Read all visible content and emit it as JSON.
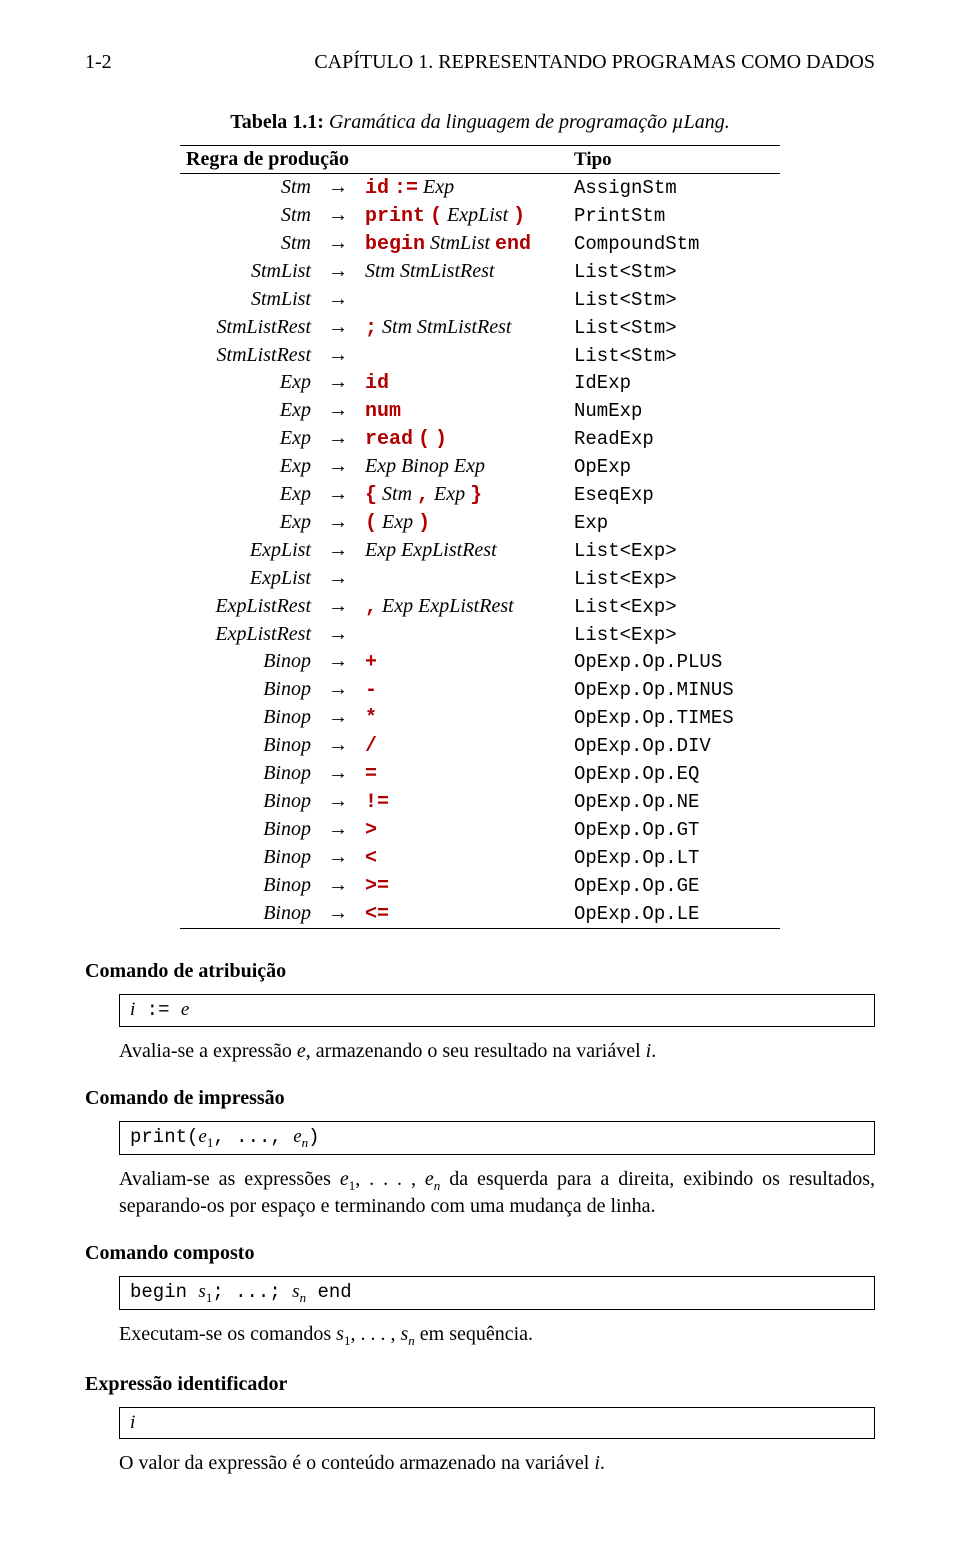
{
  "header": {
    "page_num": "1-2",
    "running": "CAPÍTULO 1.  REPRESENTANDO PROGRAMAS COMO DADOS"
  },
  "table": {
    "caption_label": "Tabela 1.1:",
    "caption_text": "Gramática da linguagem de programação µLang.",
    "head_lhs": "Regra de produção",
    "head_type": "Tipo"
  },
  "grammar": [
    {
      "lhs": "Stm",
      "rhs": "<span class='kw'>id</span> <span class='kw'>:=</span> <span class='it'>Exp</span>",
      "type": "AssignStm"
    },
    {
      "lhs": "Stm",
      "rhs": "<span class='kw'>print</span> <span class='kw'>(</span> <span class='it'>ExpList</span> <span class='kw'>)</span>",
      "type": "PrintStm"
    },
    {
      "lhs": "Stm",
      "rhs": "<span class='kw'>begin</span> <span class='it'>StmList</span> <span class='kw'>end</span>",
      "type": "CompoundStm"
    },
    {
      "lhs": "StmList",
      "rhs": "<span class='it'>Stm StmListRest</span>",
      "type": "List&lt;Stm&gt;"
    },
    {
      "lhs": "StmList",
      "rhs": "",
      "type": "List&lt;Stm&gt;"
    },
    {
      "lhs": "StmListRest",
      "rhs": "<span class='kw'>;</span> <span class='it'>Stm StmListRest</span>",
      "type": "List&lt;Stm&gt;"
    },
    {
      "lhs": "StmListRest",
      "rhs": "",
      "type": "List&lt;Stm&gt;"
    },
    {
      "lhs": "Exp",
      "rhs": "<span class='kw'>id</span>",
      "type": "IdExp"
    },
    {
      "lhs": "Exp",
      "rhs": "<span class='kw'>num</span>",
      "type": "NumExp"
    },
    {
      "lhs": "Exp",
      "rhs": "<span class='kw'>read</span> <span class='kw'>(</span> <span class='kw'>)</span>",
      "type": "ReadExp"
    },
    {
      "lhs": "Exp",
      "rhs": "<span class='it'>Exp Binop Exp</span>",
      "type": "OpExp"
    },
    {
      "lhs": "Exp",
      "rhs": "<span class='kw'>{</span> <span class='it'>Stm</span> <span class='kw'>,</span> <span class='it'>Exp</span> <span class='kw'>}</span>",
      "type": "EseqExp"
    },
    {
      "lhs": "Exp",
      "rhs": "<span class='kw'>(</span> <span class='it'>Exp</span> <span class='kw'>)</span>",
      "type": "Exp"
    },
    {
      "lhs": "ExpList",
      "rhs": "<span class='it'>Exp ExpListRest</span>",
      "type": "List&lt;Exp&gt;"
    },
    {
      "lhs": "ExpList",
      "rhs": "",
      "type": "List&lt;Exp&gt;"
    },
    {
      "lhs": "ExpListRest",
      "rhs": "<span class='kw'>,</span> <span class='it'>Exp ExpListRest</span>",
      "type": "List&lt;Exp&gt;"
    },
    {
      "lhs": "ExpListRest",
      "rhs": "",
      "type": "List&lt;Exp&gt;"
    },
    {
      "lhs": "Binop",
      "rhs": "<span class='kw'>+</span>",
      "type": "OpExp.Op.PLUS"
    },
    {
      "lhs": "Binop",
      "rhs": "<span class='kw'>-</span>",
      "type": "OpExp.Op.MINUS"
    },
    {
      "lhs": "Binop",
      "rhs": "<span class='kw'>*</span>",
      "type": "OpExp.Op.TIMES"
    },
    {
      "lhs": "Binop",
      "rhs": "<span class='kw'>/</span>",
      "type": "OpExp.Op.DIV"
    },
    {
      "lhs": "Binop",
      "rhs": "<span class='kw'>=</span>",
      "type": "OpExp.Op.EQ"
    },
    {
      "lhs": "Binop",
      "rhs": "<span class='kw'>!=</span>",
      "type": "OpExp.Op.NE"
    },
    {
      "lhs": "Binop",
      "rhs": "<span class='kw'>&gt;</span>",
      "type": "OpExp.Op.GT"
    },
    {
      "lhs": "Binop",
      "rhs": "<span class='kw'>&lt;</span>",
      "type": "OpExp.Op.LT"
    },
    {
      "lhs": "Binop",
      "rhs": "<span class='kw'>&gt;=</span>",
      "type": "OpExp.Op.GE"
    },
    {
      "lhs": "Binop",
      "rhs": "<span class='kw'>&lt;=</span>",
      "type": "OpExp.Op.LE"
    }
  ],
  "sections": {
    "assign": {
      "title": "Comando de atribuição",
      "code": "<span class='it'>i</span> := <span class='it'>e</span>",
      "body": "Avalia-se a expressão <span class='it'>e</span>, armazenando o seu resultado na variável <span class='it'>i</span>."
    },
    "print": {
      "title": "Comando de impressão",
      "code": "print(<span class='it'>e</span><span class='sub'>1</span>, ..., <span class='it'>e</span><span class='sub it'>n</span>)",
      "body": "Avaliam-se as expressões <span class='it'>e</span><span class='sub'>1</span>, . . . , <span class='it'>e</span><span class='sub it'>n</span> da esquerda para a direita, exibindo os resultados, separando-os por espaço e terminando com uma mudança de linha."
    },
    "compound": {
      "title": "Comando composto",
      "code": "begin <span class='it'>s</span><span class='sub'>1</span>; ...; <span class='it'>s</span><span class='sub it'>n</span> end",
      "body": "Executam-se os comandos <span class='it'>s</span><span class='sub'>1</span>, . . . , <span class='it'>s</span><span class='sub it'>n</span> em sequência."
    },
    "idexp": {
      "title": "Expressão identificador",
      "code": "<span class='it'>i</span>",
      "body": "O valor da expressão é o conteúdo armazenado na variável <span class='it'>i</span>."
    }
  }
}
